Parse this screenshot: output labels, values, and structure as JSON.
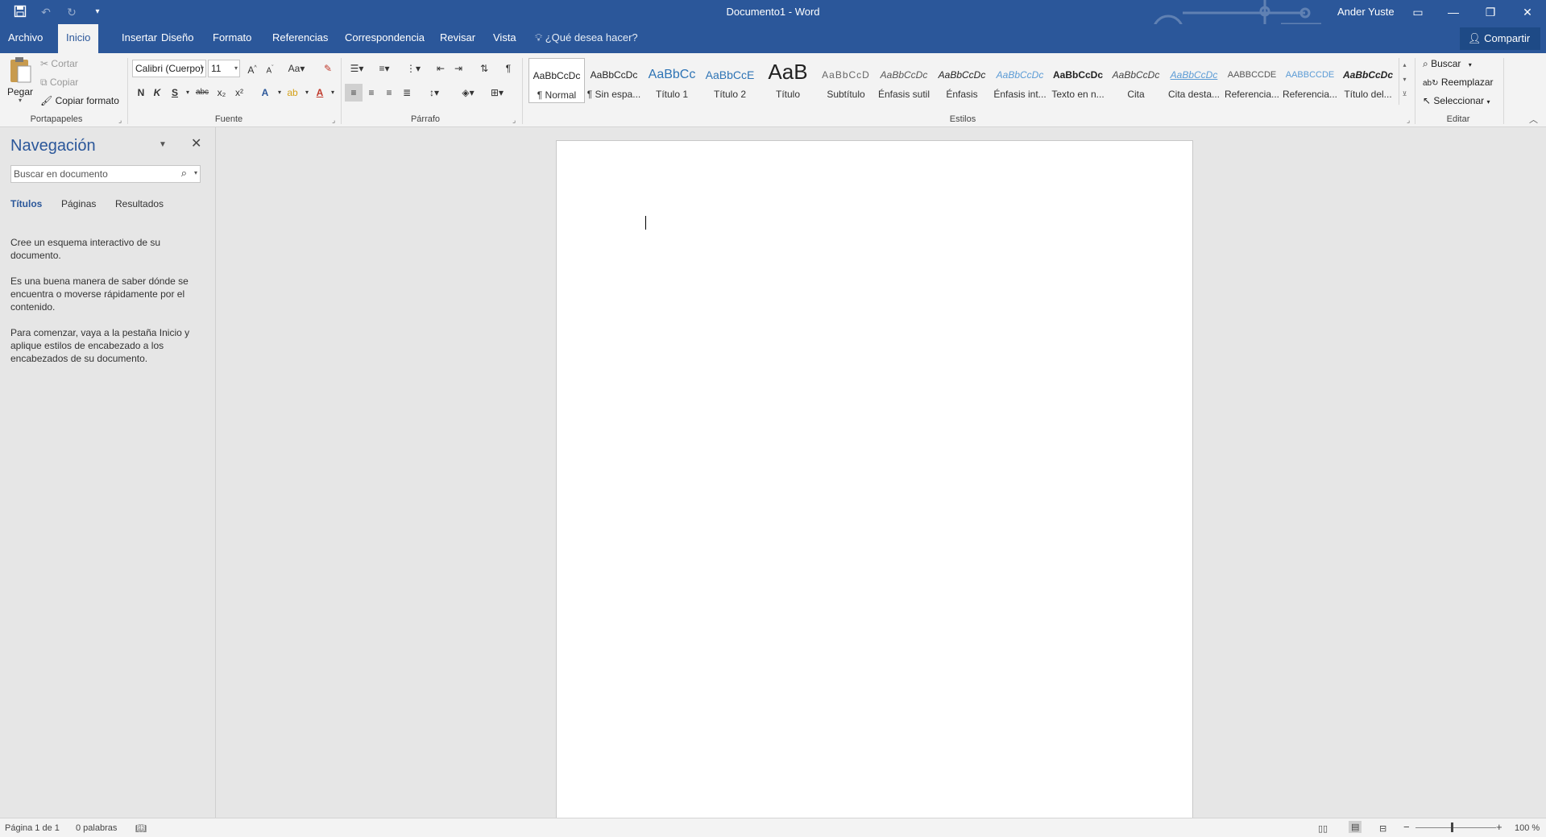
{
  "window": {
    "title": "Documento1 - Word",
    "user": "Ander Yuste",
    "buttons": {
      "ribbon_display": "ribbon-display-icon",
      "minimize": "minimize-icon",
      "restore": "restore-icon",
      "close": "close-icon"
    }
  },
  "quick_access": {
    "save_icon": "save-icon",
    "undo_icon": "undo-icon",
    "redo_icon": "redo-icon",
    "customize_icon": "customize-qat-icon"
  },
  "tabs": [
    {
      "label": "Archivo"
    },
    {
      "label": "Inicio",
      "active": true
    },
    {
      "label": "Insertar"
    },
    {
      "label": "Diseño"
    },
    {
      "label": "Formato"
    },
    {
      "label": "Referencias"
    },
    {
      "label": "Correspondencia"
    },
    {
      "label": "Revisar"
    },
    {
      "label": "Vista"
    }
  ],
  "tell_me": "¿Qué desea hacer?",
  "share": "Compartir",
  "ribbon": {
    "clipboard": {
      "label": "Portapapeles",
      "paste": "Pegar",
      "cut": "Cortar",
      "copy": "Copiar",
      "format_painter": "Copiar formato"
    },
    "font": {
      "label": "Fuente",
      "font_name": "Calibri (Cuerpo)",
      "font_size": "11",
      "bold": "N",
      "italic": "K",
      "underline": "S",
      "strike": "abc",
      "subscript": "x₂",
      "superscript": "x²",
      "change_case": "Aa"
    },
    "paragraph": {
      "label": "Párrafo"
    },
    "styles": {
      "label": "Estilos",
      "items": [
        {
          "preview": "AaBbCcDc",
          "name": "¶ Normal",
          "active": true
        },
        {
          "preview": "AaBbCcDc",
          "name": "¶ Sin espa..."
        },
        {
          "preview": "AaBbCc",
          "name": "Título 1"
        },
        {
          "preview": "AaBbCcE",
          "name": "Título 2"
        },
        {
          "preview": "AaB",
          "name": "Título"
        },
        {
          "preview": "AaBbCcD",
          "name": "Subtítulo"
        },
        {
          "preview": "AaBbCcDc",
          "name": "Énfasis sutil"
        },
        {
          "preview": "AaBbCcDc",
          "name": "Énfasis"
        },
        {
          "preview": "AaBbCcDc",
          "name": "Énfasis int..."
        },
        {
          "preview": "AaBbCcDc",
          "name": "Texto en n..."
        },
        {
          "preview": "AaBbCcDc",
          "name": "Cita"
        },
        {
          "preview": "AaBbCcDc",
          "name": "Cita desta..."
        },
        {
          "preview": "AABBCCDE",
          "name": "Referencia..."
        },
        {
          "preview": "AABBCCDE",
          "name": "Referencia..."
        },
        {
          "preview": "AaBbCcDc",
          "name": "Título del..."
        }
      ]
    },
    "editing": {
      "label": "Editar",
      "find": "Buscar",
      "replace": "Reemplazar",
      "select": "Seleccionar"
    }
  },
  "nav_pane": {
    "title": "Navegación",
    "search_placeholder": "Buscar en documento",
    "tabs": [
      "Títulos",
      "Páginas",
      "Resultados"
    ],
    "paragraphs": [
      "Cree un esquema interactivo de su documento.",
      "Es una buena manera de saber dónde se encuentra o moverse rápidamente por el contenido.",
      "Para comenzar, vaya a la pestaña Inicio y aplique estilos de encabezado a los encabezados de su documento."
    ]
  },
  "status": {
    "page": "Página 1 de 1",
    "words": "0 palabras",
    "zoom": "100 %",
    "zoom_level_percent": 100
  },
  "colors": {
    "accent": "#2b579a",
    "ribbon_bg": "#f3f3f3",
    "workspace_bg": "#e6e6e6"
  }
}
